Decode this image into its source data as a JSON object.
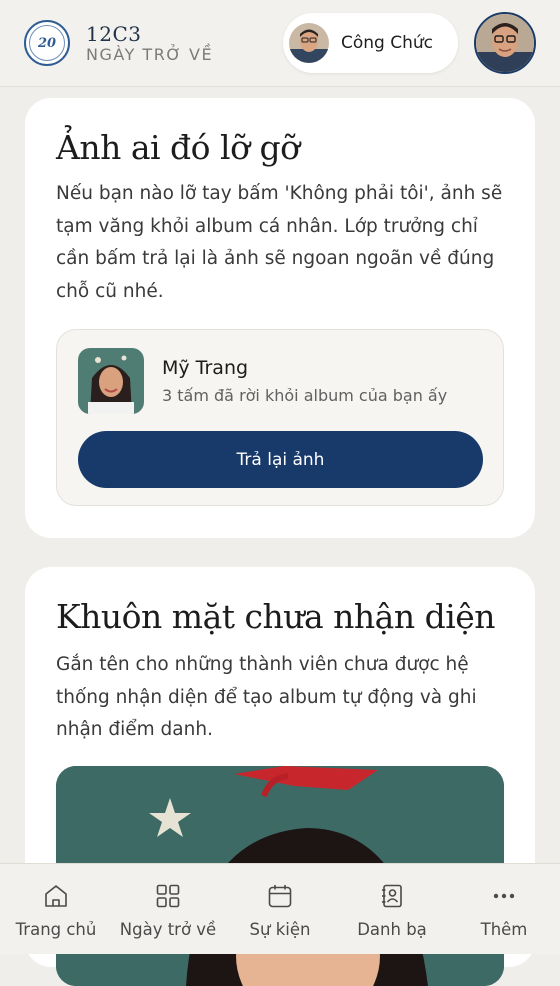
{
  "header": {
    "logo_text": "20",
    "class_name": "12C3",
    "subtitle": "NGÀY TRỞ VỀ",
    "role_label": "Công Chức"
  },
  "restore_card": {
    "title": "Ảnh ai đó lỡ gỡ",
    "description": "Nếu bạn nào lỡ tay bấm 'Không phải tôi', ảnh sẽ tạm văng khỏi album cá nhân. Lớp trưởng chỉ cần bấm trả lại là ảnh sẽ ngoan ngoãn về đúng chỗ cũ nhé.",
    "person": {
      "name": "Mỹ Trang",
      "note": "3 tấm đã rời khỏi album của bạn ấy"
    },
    "button_label": "Trả lại ảnh"
  },
  "faces_card": {
    "title": "Khuôn mặt chưa nhận diện",
    "description": "Gắn tên cho những thành viên chưa được hệ thống nhận diện để tạo album tự động và ghi nhận điểm danh."
  },
  "bottom_nav": {
    "items": [
      {
        "label": "Trang chủ",
        "icon": "home-icon"
      },
      {
        "label": "Ngày trở về",
        "icon": "grid-icon"
      },
      {
        "label": "Sự kiện",
        "icon": "calendar-icon"
      },
      {
        "label": "Danh bạ",
        "icon": "contacts-icon"
      },
      {
        "label": "Thêm",
        "icon": "more-icon"
      }
    ]
  },
  "colors": {
    "primary": "#173a6b",
    "background": "#f0eeea",
    "card": "#ffffff"
  }
}
